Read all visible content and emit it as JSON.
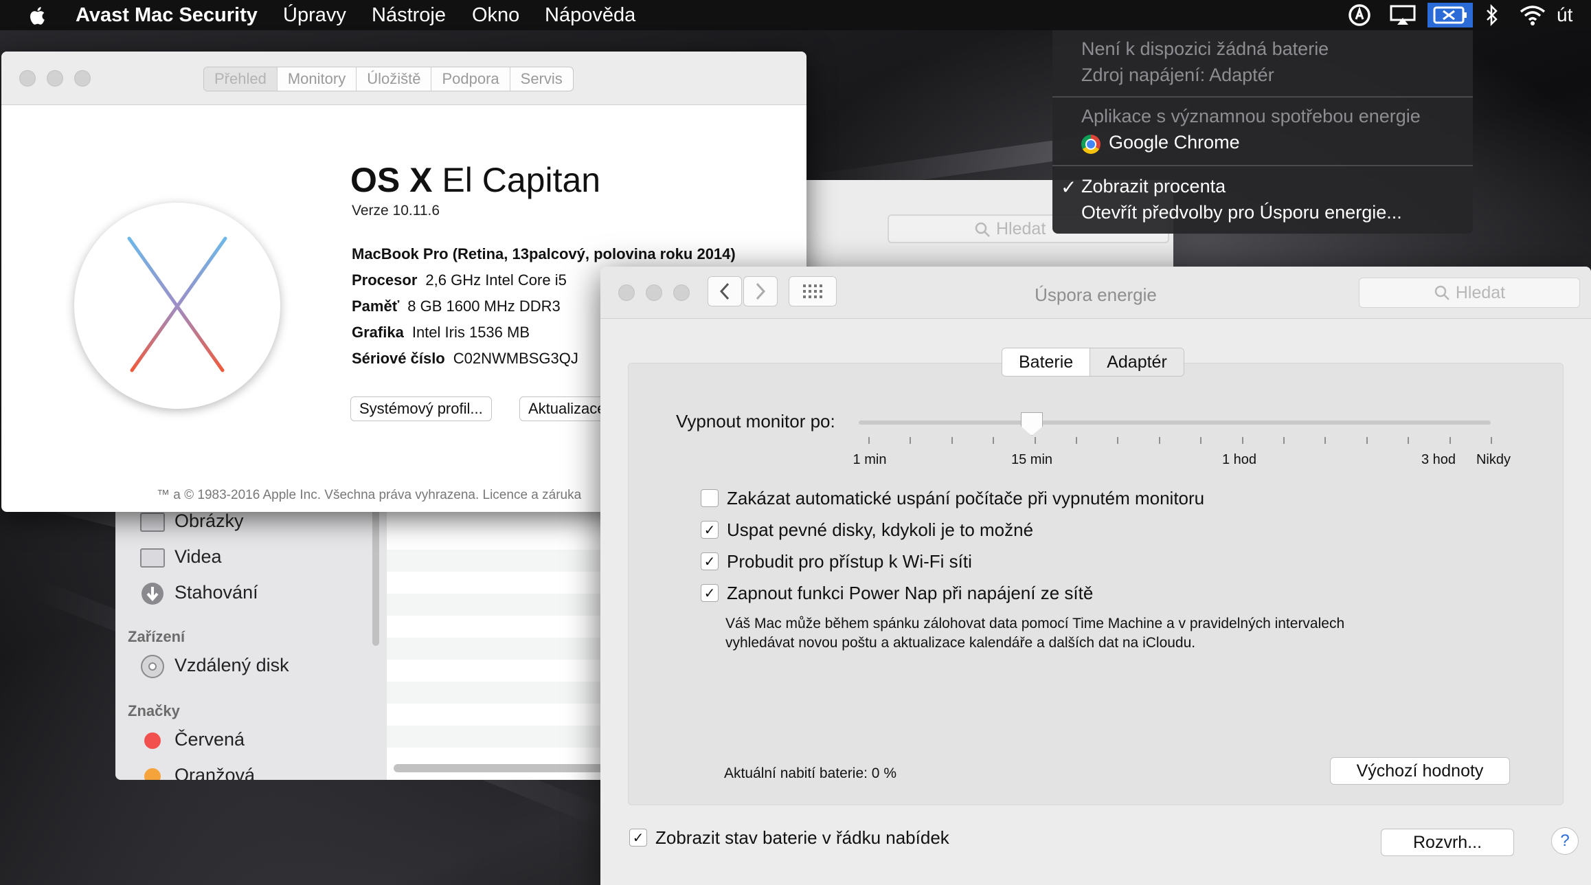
{
  "menubar": {
    "app_name": "Avast Mac Security",
    "items": [
      "Úpravy",
      "Nástroje",
      "Okno",
      "Nápověda"
    ],
    "clock": "út"
  },
  "battery_menu": {
    "no_battery": "Není k dispozici žádná baterie",
    "power_source": "Zdroj napájení: Adaptér",
    "apps_header": "Aplikace s významnou spotřebou energie",
    "app": "Google Chrome",
    "show_percent": "Zobrazit procenta",
    "show_percent_checked": true,
    "check_mark": "✓",
    "open_prefs": "Otevřít předvolby pro Úsporu energie..."
  },
  "about": {
    "tabs": [
      "Přehled",
      "Monitory",
      "Úložiště",
      "Podpora",
      "Servis"
    ],
    "selected_tab": "Přehled",
    "os_name_bold": "OS X",
    "os_name_light": "El Capitan",
    "version": "Verze 10.11.6",
    "model": "MacBook Pro (Retina, 13palcový, polovina roku 2014)",
    "specs": [
      {
        "label": "Procesor",
        "value": "2,6 GHz Intel Core i5"
      },
      {
        "label": "Paměť",
        "value": "8 GB 1600 MHz DDR3"
      },
      {
        "label": "Grafika",
        "value": "Intel Iris 1536 MB"
      },
      {
        "label": "Sériové číslo",
        "value": "C02NWMBSG3QJ"
      }
    ],
    "system_report_button": "Systémový profil...",
    "update_button": "Aktualizace softwaru...",
    "copyright": "™ a © 1983-2016 Apple Inc. Všechna práva vyhrazena. Licence a záruka"
  },
  "finder": {
    "items": [
      "Obrázky",
      "Videa",
      "Stahování"
    ],
    "devices_header": "Zařízení",
    "device": "Vzdálený disk",
    "tags_header": "Značky",
    "tags": [
      {
        "name": "Červená",
        "color": "#f2504f"
      },
      {
        "name": "Oranžová",
        "color": "#f5a33b"
      }
    ]
  },
  "hidden_window": {
    "search_placeholder": "Hledat"
  },
  "energy": {
    "title": "Úspora energie",
    "search_placeholder": "Hledat",
    "tabs": [
      "Baterie",
      "Adaptér"
    ],
    "selected_tab": "Baterie",
    "slider_label": "Vypnout monitor po:",
    "slider_value": "15 min",
    "tick_labels": [
      "1 min",
      "15 min",
      "1 hod",
      "3 hod",
      "Nikdy"
    ],
    "options": [
      {
        "label": "Zakázat automatické uspání počítače při vypnutém monitoru",
        "checked": false
      },
      {
        "label": "Uspat pevné disky, kdykoli je to možné",
        "checked": true
      },
      {
        "label": "Probudit pro přístup k Wi-Fi síti",
        "checked": true
      },
      {
        "label": "Zapnout funkci Power Nap při napájení ze sítě",
        "checked": true
      }
    ],
    "powernap_desc_1": "Váš Mac může během spánku zálohovat data pomocí Time Machine a v pravidelných intervalech",
    "powernap_desc_2": "vyhledávat novou poštu a aktualizace kalendáře a dalších dat na iCloudu.",
    "charge_status": "Aktuální nabití baterie: 0 %",
    "defaults_button": "Výchozí hodnoty",
    "show_status_label": "Zobrazit stav baterie v řádku nabídek",
    "show_status_checked": true,
    "schedule_button": "Rozvrh...",
    "help": "?"
  },
  "colors": {
    "accent": "#2a6bd8",
    "menubar": "#111112"
  }
}
